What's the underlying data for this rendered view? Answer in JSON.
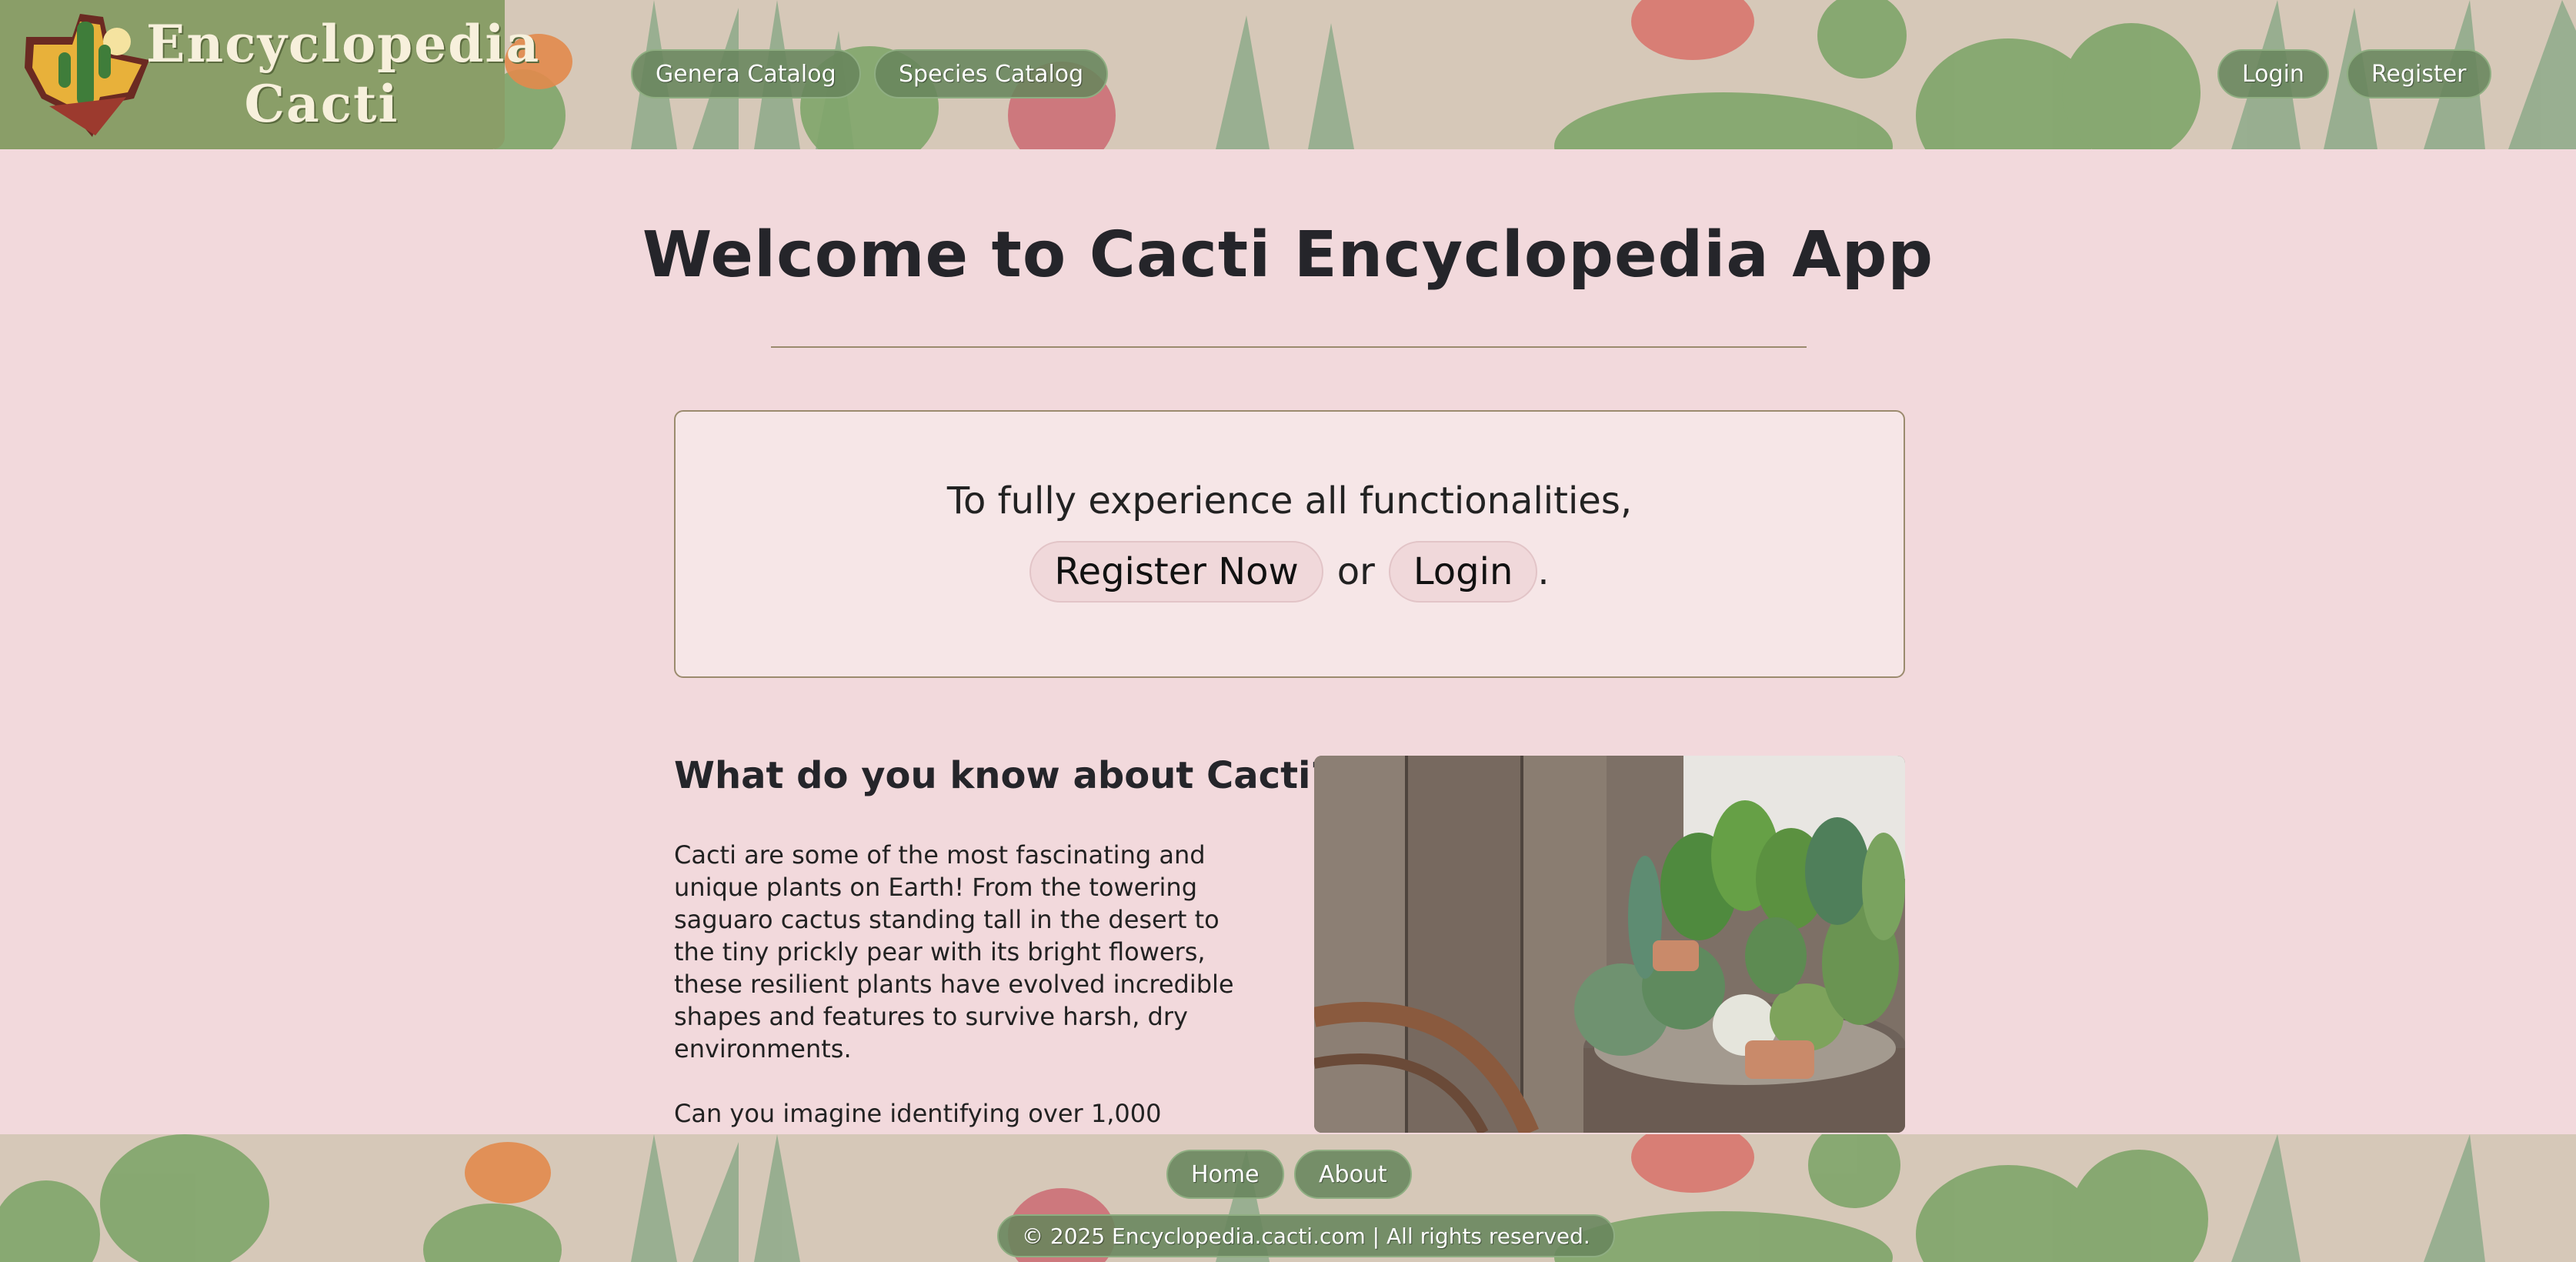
{
  "header": {
    "logo_line1": "Encyclopedia",
    "logo_line2": "Cacti",
    "nav": {
      "genera_catalog": "Genera Catalog",
      "species_catalog": "Species Catalog"
    },
    "auth": {
      "login": "Login",
      "register": "Register"
    }
  },
  "main": {
    "title": "Welcome to Cacti Encyclopedia App",
    "cta": {
      "line1": "To fully experience all functionalities,",
      "register_now": "Register Now",
      "or": "or",
      "login": "Login",
      "period": "."
    },
    "about": {
      "heading": "What do you know about Cacti?",
      "paragraph1": "Cacti are some of the most fascinating and unique plants on Earth! From the towering saguaro cactus standing tall in the desert to the tiny prickly pear with its bright flowers, these resilient plants have evolved incredible shapes and features to survive harsh, dry environments.",
      "paragraph2": "Can you imagine identifying over 1,000"
    }
  },
  "footer": {
    "home": "Home",
    "about": "About",
    "copyright": "© 2025 Encyclopedia.cacti.com | All rights reserved."
  },
  "colors": {
    "page_background": "#f2d9dc",
    "logo_background": "#8a9e68",
    "pill_background": "#68855c",
    "cta_box_background": "#f6e6e7",
    "cta_border": "#9b8b6e"
  },
  "icons": {
    "logo": "cactus-emblem-icon"
  }
}
